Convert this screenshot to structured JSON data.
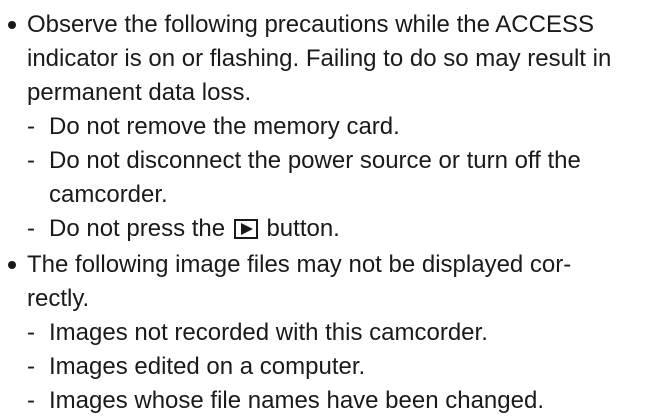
{
  "bullets": [
    {
      "lines": [
        "Observe the following precautions while the ACCESS",
        "indicator is on or flashing. Failing to do so may result in",
        "permanent data loss."
      ],
      "subitems": [
        {
          "lines": [
            "Do not remove the memory card."
          ]
        },
        {
          "lines": [
            "Do not disconnect the power source or turn off the",
            "camcorder."
          ]
        },
        {
          "prefix": "Do not press the",
          "icon": "play-button-icon",
          "suffix": "button."
        }
      ]
    },
    {
      "lines": [
        "The following image files may not be displayed cor-",
        "rectly."
      ],
      "subitems": [
        {
          "lines": [
            "Images not recorded with this camcorder."
          ]
        },
        {
          "lines": [
            "Images edited on a computer."
          ]
        },
        {
          "lines": [
            "Images whose file names have been changed."
          ]
        }
      ]
    }
  ],
  "dash": "-"
}
